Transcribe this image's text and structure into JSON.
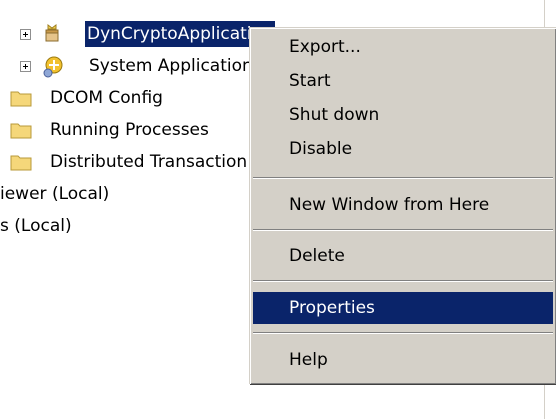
{
  "tree": {
    "items": [
      {
        "label": "DynCryptoApplication",
        "icon": "component-package-icon",
        "expandable": true,
        "selected": true
      },
      {
        "label": "System Application",
        "icon": "component-gear-icon",
        "expandable": true,
        "selected": false
      },
      {
        "label": "DCOM Config",
        "icon": "folder-icon",
        "expandable": false,
        "selected": false
      },
      {
        "label": "Running Processes",
        "icon": "folder-icon",
        "expandable": false,
        "selected": false
      },
      {
        "label": "Distributed Transaction Coordinator",
        "icon": "folder-icon",
        "expandable": false,
        "selected": false
      },
      {
        "label": "iewer (Local)",
        "icon": "",
        "expandable": false,
        "selected": false
      },
      {
        "label": "s (Local)",
        "icon": "",
        "expandable": false,
        "selected": false
      }
    ]
  },
  "context_menu": {
    "groups": [
      [
        "Export...",
        "Start",
        "Shut down",
        "Disable"
      ],
      [
        "New Window from Here"
      ],
      [
        "Delete"
      ],
      [
        "Properties"
      ],
      [
        "Help"
      ]
    ],
    "highlighted": "Properties"
  },
  "colors": {
    "selection": "#0a246a",
    "menu_face": "#d4d0c8",
    "folder": "#f5d77a"
  }
}
